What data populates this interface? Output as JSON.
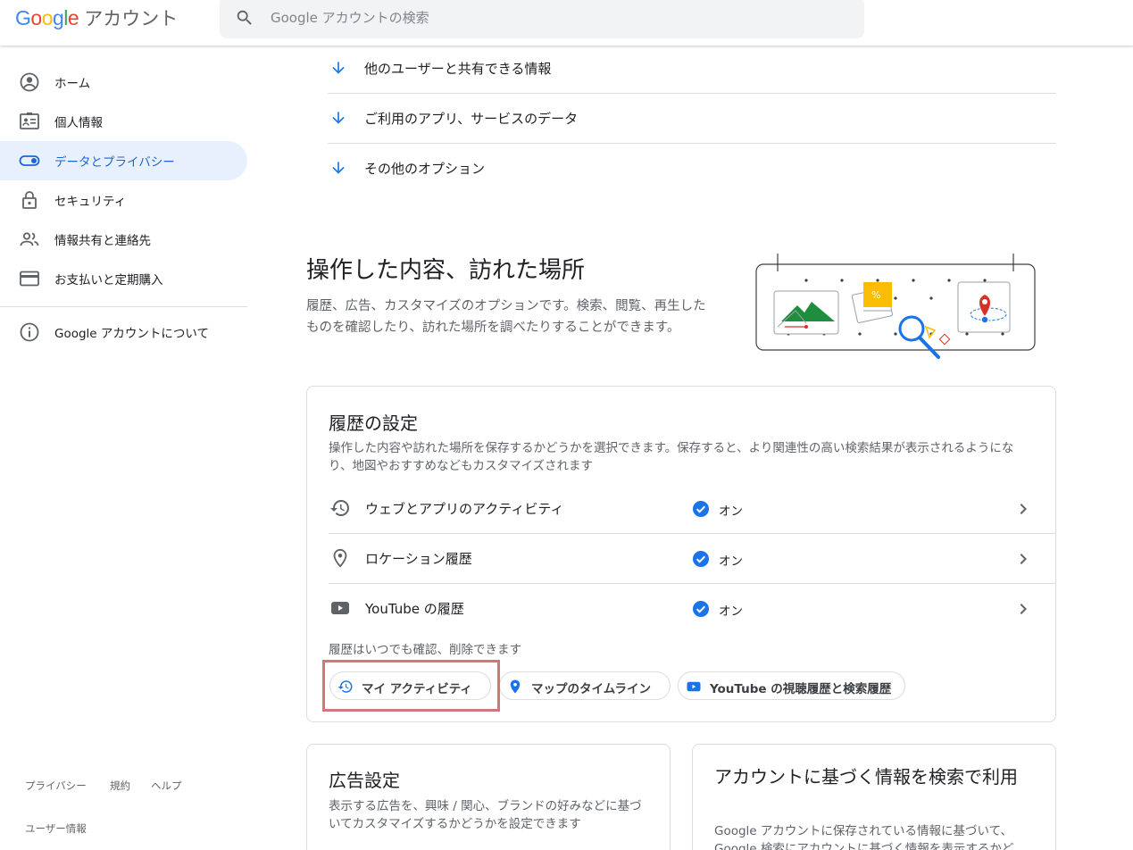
{
  "header": {
    "logo_google": "Google",
    "logo_product": "アカウント",
    "search_placeholder": "Google アカウントの検索"
  },
  "sidebar": {
    "items": [
      {
        "label": "ホーム",
        "icon": "account-circle-icon"
      },
      {
        "label": "個人情報",
        "icon": "id-card-icon"
      },
      {
        "label": "データとプライバシー",
        "icon": "toggle-icon",
        "active": true
      },
      {
        "label": "セキュリティ",
        "icon": "lock-icon"
      },
      {
        "label": "情報共有と連絡先",
        "icon": "people-icon"
      },
      {
        "label": "お支払いと定期購入",
        "icon": "credit-card-icon"
      }
    ],
    "about": {
      "label": "Google アカウントについて",
      "icon": "info-icon"
    },
    "footer": {
      "privacy": "プライバシー",
      "terms": "規約",
      "help": "ヘルプ",
      "user_info": "ユーザー情報"
    }
  },
  "anchors": [
    {
      "label": "他のユーザーと共有できる情報",
      "icon": "arrow-down-icon"
    },
    {
      "label": "ご利用のアプリ、サービスのデータ",
      "icon": "arrow-down-icon"
    },
    {
      "label": "その他のオプション",
      "icon": "arrow-down-icon"
    }
  ],
  "section": {
    "title": "操作した内容、訪れた場所",
    "description": "履歴、広告、カスタマイズのオプションです。検索、閲覧、再生したものを確認したり、訪れた場所を調べたりすることができます。"
  },
  "history_card": {
    "title": "履歴の設定",
    "description": "操作した内容や訪れた場所を保存するかどうかを選択できます。保存すると、より関連性の高い検索結果が表示されるようになり、地図やおすすめなどもカスタマイズされます",
    "rows": [
      {
        "label": "ウェブとアプリのアクティビティ",
        "status": "オン",
        "icon": "history-icon"
      },
      {
        "label": "ロケーション履歴",
        "status": "オン",
        "icon": "location-pin-icon"
      },
      {
        "label": "YouTube の履歴",
        "status": "オン",
        "icon": "youtube-icon"
      }
    ],
    "note": "履歴はいつでも確認、削除できます",
    "chips": [
      {
        "label": "マイ アクティビティ",
        "icon": "history-icon"
      },
      {
        "label": "マップのタイムライン",
        "icon": "location-pin-icon"
      },
      {
        "label": "YouTube の視聴履歴と検索履歴",
        "icon": "youtube-icon"
      }
    ]
  },
  "ads_card": {
    "title": "広告設定",
    "description": "表示する広告を、興味 / 関心、ブランドの好みなどに基づいてカスタマイズするかどうかを設定できます"
  },
  "search_card": {
    "title": "アカウントに基づく情報を検索で利用",
    "description": "Google アカウントに保存されている情報に基づいて、Google 検索にアカウントに基づく情報を表示するかど"
  },
  "colors": {
    "accent": "#1a73e8",
    "active_bg": "#e8f0fe",
    "highlight": "#d07878"
  }
}
